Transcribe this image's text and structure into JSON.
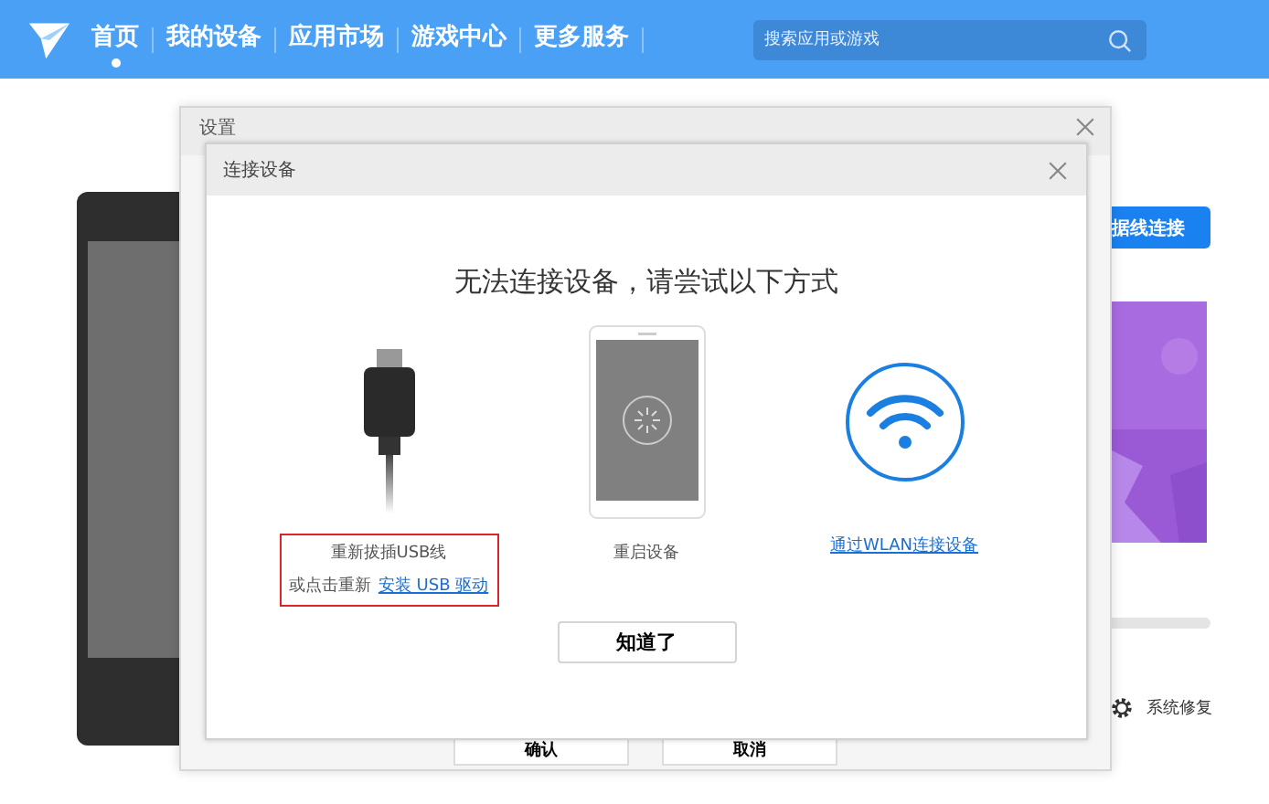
{
  "nav": {
    "items": [
      {
        "label": "首页",
        "selected": true
      },
      {
        "label": "我的设备",
        "selected": false
      },
      {
        "label": "应用市场",
        "selected": false
      },
      {
        "label": "游戏中心",
        "selected": false
      },
      {
        "label": "更多服务",
        "selected": false
      }
    ]
  },
  "search": {
    "placeholder": "搜索应用或游戏"
  },
  "background": {
    "connect_button": "据线连接",
    "repair": "系统修复"
  },
  "settings_window": {
    "title": "设置",
    "buttons": [
      "确认",
      "取消"
    ]
  },
  "dialog": {
    "title": "连接设备",
    "heading": "无法连接设备，请尝试以下方式",
    "options": [
      {
        "kind": "usb",
        "label": "重新拔插USB线",
        "prefix": "或点击重新",
        "link": "安装 USB 驱动",
        "highlighted": true
      },
      {
        "kind": "restart",
        "label": "重启设备",
        "highlighted": false
      },
      {
        "kind": "wlan",
        "link": "通过WLAN连接设备",
        "highlighted": false
      }
    ],
    "ok_button": "知道了"
  }
}
